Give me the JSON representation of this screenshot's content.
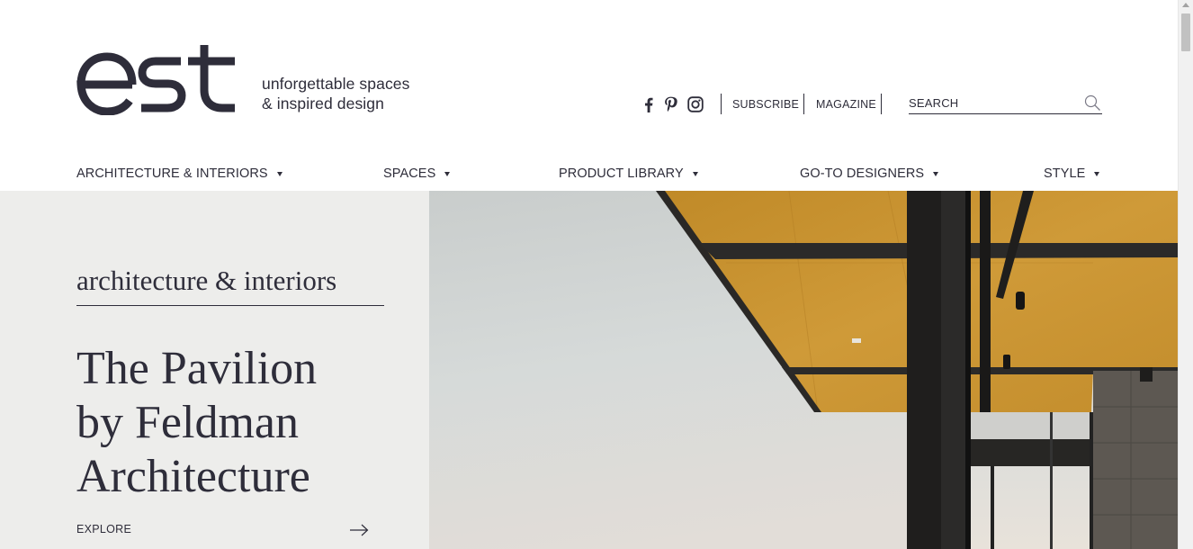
{
  "brand": {
    "logo_text": "est",
    "tagline_line1": "unforgettable spaces",
    "tagline_line2": "& inspired design"
  },
  "header": {
    "social_icons": [
      "facebook-icon",
      "pinterest-icon",
      "instagram-icon"
    ],
    "subscribe_label": "SUBSCRIBE",
    "magazine_label": "MAGAZINE",
    "search_placeholder": "SEARCH"
  },
  "nav": {
    "items": [
      {
        "label": "ARCHITECTURE & INTERIORS"
      },
      {
        "label": "SPACES"
      },
      {
        "label": "PRODUCT LIBRARY"
      },
      {
        "label": "GO-TO DESIGNERS"
      },
      {
        "label": "STYLE"
      }
    ]
  },
  "hero": {
    "category": "architecture & interiors",
    "title_line1": "The Pavilion",
    "title_line2": "by Feldman",
    "title_line3": "Architecture",
    "cta_label": "EXPLORE"
  },
  "colors": {
    "text": "#2e2d3a",
    "hero_panel": "#ededeb",
    "canopy": "#c9922b",
    "sky": "#d3d7d6"
  }
}
